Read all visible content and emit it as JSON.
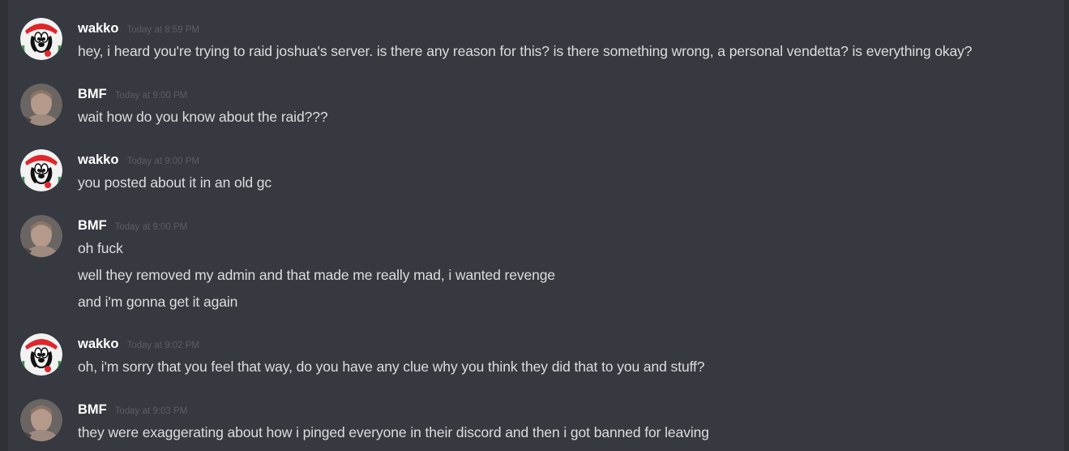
{
  "messages": [
    {
      "author": "wakko",
      "avatar": "wakko-avatar",
      "timestamp": "Today at 8:59 PM",
      "lines": [
        "hey, i heard you're trying to raid joshua's server. is there any reason for this? is there something wrong, a personal vendetta? is everything okay?"
      ]
    },
    {
      "author": "BMF",
      "avatar": "bmf-avatar",
      "timestamp": "Today at 9:00 PM",
      "lines": [
        "wait how do you know about the raid???"
      ]
    },
    {
      "author": "wakko",
      "avatar": "wakko-avatar",
      "timestamp": "Today at 9:00 PM",
      "lines": [
        "you posted about it in an old gc"
      ]
    },
    {
      "author": "BMF",
      "avatar": "bmf-avatar",
      "timestamp": "Today at 9:00 PM",
      "lines": [
        "oh fuck",
        "well they removed my admin and that made me really mad, i wanted revenge",
        "and i'm gonna get it again"
      ]
    },
    {
      "author": "wakko",
      "avatar": "wakko-avatar",
      "timestamp": "Today at 9:02 PM",
      "lines": [
        "oh, i'm sorry that you feel that way, do you have any clue why you think they did that to you and stuff?"
      ]
    },
    {
      "author": "BMF",
      "avatar": "bmf-avatar",
      "timestamp": "Today at 9:03 PM",
      "lines": [
        "they were exaggerating about how i pinged everyone in their discord and then i got banned for leaving"
      ]
    }
  ],
  "colors": {
    "background": "#36393f",
    "username": "#ffffff",
    "message_text": "#dcddde",
    "timestamp": "#5b5e63"
  }
}
